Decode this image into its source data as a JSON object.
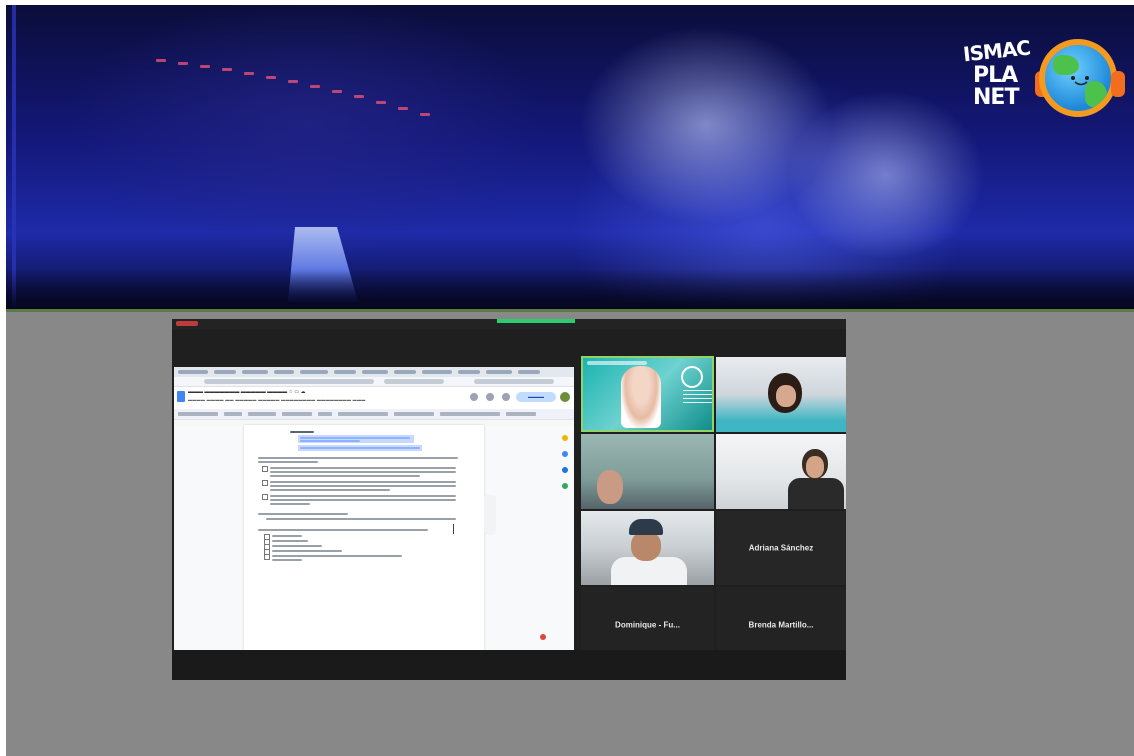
{
  "banner": {
    "logo_text_1": "ISMAC",
    "logo_text_2": "PLA NET"
  },
  "meeting": {
    "participants": [
      {
        "name": ""
      },
      {
        "name": ""
      },
      {
        "name": ""
      },
      {
        "name": ""
      },
      {
        "name": ""
      },
      {
        "name": "Adriana Sánchez"
      },
      {
        "name": "Dominique - Fu..."
      },
      {
        "name": "Brenda Martillo..."
      }
    ]
  },
  "colors": {
    "banner_blue": "#1e2aa8",
    "page_grey": "#888888",
    "meeting_bg": "#1f1f1f",
    "active_speaker_border": "#8fd36a",
    "screen_share_indicator": "#2ecc71"
  }
}
